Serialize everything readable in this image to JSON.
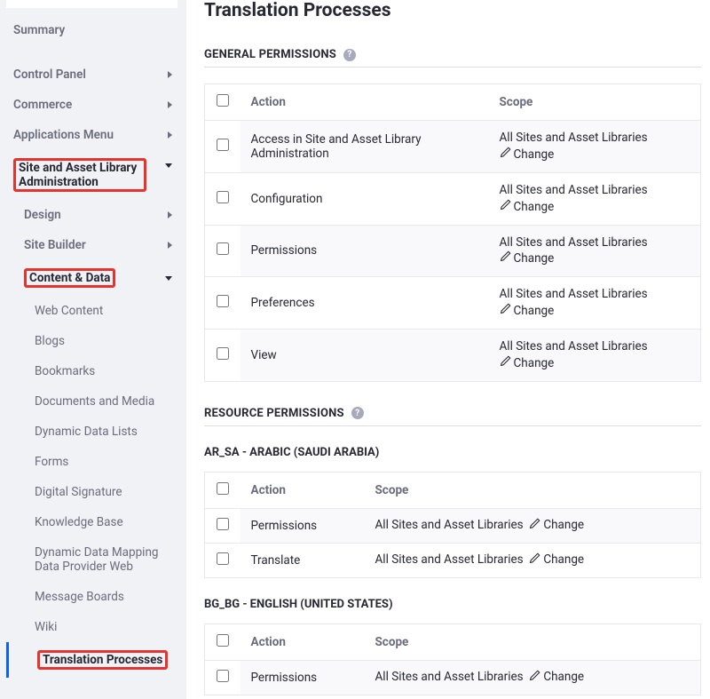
{
  "sidebar": {
    "summary": "Summary",
    "control_panel": "Control Panel",
    "commerce": "Commerce",
    "applications_menu": "Applications Menu",
    "site_asset_admin": "Site and Asset Library Administration",
    "design": "Design",
    "site_builder": "Site Builder",
    "content_data": "Content & Data",
    "items3": [
      "Web Content",
      "Blogs",
      "Bookmarks",
      "Documents and Media",
      "Dynamic Data Lists",
      "Forms",
      "Digital Signature",
      "Knowledge Base",
      "Dynamic Data Mapping Data Provider Web",
      "Message Boards",
      "Wiki",
      "Translation Processes"
    ]
  },
  "main": {
    "title": "Translation Processes",
    "general_heading": "GENERAL PERMISSIONS",
    "resource_heading": "RESOURCE PERMISSIONS",
    "col_action": "Action",
    "col_scope": "Scope",
    "scope_text": "All Sites and Asset Libraries",
    "change_text": "Change",
    "general_rows": [
      "Access in Site and Asset Library Administration",
      "Configuration",
      "Permissions",
      "Preferences",
      "View"
    ],
    "resource_groups": [
      {
        "heading": "AR_SA - ARABIC (SAUDI ARABIA)",
        "rows": [
          "Permissions",
          "Translate"
        ]
      },
      {
        "heading": "BG_BG - ENGLISH (UNITED STATES)",
        "rows": [
          "Permissions"
        ]
      }
    ]
  }
}
